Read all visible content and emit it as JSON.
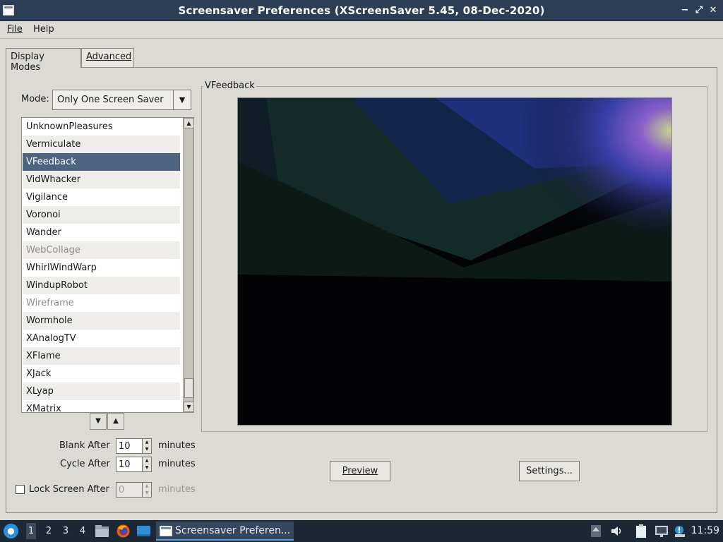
{
  "window": {
    "title": "Screensaver Preferences  (XScreenSaver 5.45, 08-Dec-2020)",
    "controls": [
      "minimize",
      "maximize",
      "close"
    ]
  },
  "menu": {
    "file": "File",
    "help": "Help"
  },
  "tabs": {
    "display_modes": "Display Modes",
    "advanced": "Advanced"
  },
  "mode": {
    "label": "Mode:",
    "value": "Only One Screen Saver"
  },
  "savers": [
    {
      "name": "UnknownPleasures",
      "state": "normal"
    },
    {
      "name": "Vermiculate",
      "state": "normal"
    },
    {
      "name": "VFeedback",
      "state": "selected"
    },
    {
      "name": "VidWhacker",
      "state": "normal"
    },
    {
      "name": "Vigilance",
      "state": "normal"
    },
    {
      "name": "Voronoi",
      "state": "normal"
    },
    {
      "name": "Wander",
      "state": "normal"
    },
    {
      "name": "WebCollage",
      "state": "disabled"
    },
    {
      "name": "WhirlWindWarp",
      "state": "normal"
    },
    {
      "name": "WindupRobot",
      "state": "normal"
    },
    {
      "name": "Wireframe",
      "state": "disabled"
    },
    {
      "name": "Wormhole",
      "state": "normal"
    },
    {
      "name": "XAnalogTV",
      "state": "normal"
    },
    {
      "name": "XFlame",
      "state": "normal"
    },
    {
      "name": "XJack",
      "state": "normal"
    },
    {
      "name": "XLyap",
      "state": "normal"
    },
    {
      "name": "XMatrix",
      "state": "normal"
    }
  ],
  "blank_after": {
    "label": "Blank After",
    "value": "10",
    "unit": "minutes"
  },
  "cycle_after": {
    "label": "Cycle After",
    "value": "10",
    "unit": "minutes"
  },
  "lock_screen": {
    "label": "Lock Screen After",
    "value": "0",
    "unit": "minutes",
    "checked": false
  },
  "preview": {
    "legend": "VFeedback",
    "preview_button": "Preview",
    "settings_button": "Settings..."
  },
  "taskbar": {
    "workspaces": [
      "1",
      "2",
      "3",
      "4"
    ],
    "active_workspace": "1",
    "task_label": "Screensaver Preferen...",
    "clock": "11:59"
  },
  "colors": {
    "titlebar": "#2b3e55",
    "selection": "#4c6480",
    "taskbar": "#1c2835"
  }
}
